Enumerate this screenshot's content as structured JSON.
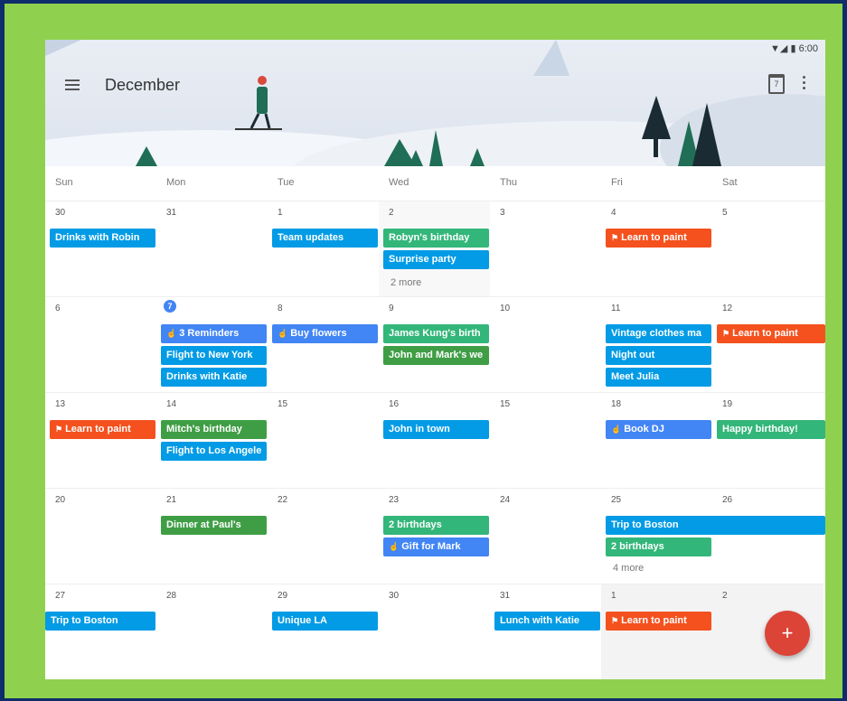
{
  "status": {
    "time": "6:00",
    "signals": "▼◢ ▮"
  },
  "header": {
    "month": "December",
    "date_icon": "7"
  },
  "weekdays": [
    "Sun",
    "Mon",
    "Tue",
    "Wed",
    "Thu",
    "Fri",
    "Sat"
  ],
  "days": [
    [
      "30",
      "31",
      "1",
      "2",
      "3",
      "4",
      "5"
    ],
    [
      "6",
      "7",
      "8",
      "9",
      "10",
      "11",
      "12"
    ],
    [
      "13",
      "14",
      "15",
      "16",
      "15",
      "18",
      "19"
    ],
    [
      "20",
      "21",
      "22",
      "23",
      "24",
      "25",
      "26"
    ],
    [
      "27",
      "28",
      "29",
      "30",
      "31",
      "1",
      "2"
    ]
  ],
  "events": {
    "drinks_robin": "Drinks with Robin",
    "team_updates": "Team updates",
    "robyn_birthday": "Robyn's birthday",
    "surprise_party": "Surprise party",
    "more_2": "2 more",
    "learn_paint": "Learn to paint",
    "reminders": "3 Reminders",
    "flight_ny": "Flight to New York",
    "drinks_katie": "Drinks with Katie",
    "buy_flowers": "Buy flowers",
    "james_kung": "James Kung's birth",
    "john_mark": "John and Mark's we",
    "vintage": "Vintage clothes ma",
    "night_out": "Night out",
    "meet_julia": "Meet Julia",
    "mitch": "Mitch's birthday",
    "flight_la": "Flight to Los Angele",
    "john_town": "John in town",
    "book_dj": "Book DJ",
    "happy_bday": "Happy birthday!",
    "dinner_paul": "Dinner at Paul's",
    "two_bdays": "2 birthdays",
    "gift_mark": "Gift for Mark",
    "trip_boston": "Trip to Boston",
    "more_4": "4 more",
    "unique_la": "Unique LA",
    "lunch_katie": "Lunch with Katie"
  },
  "fab_label": "+",
  "colors": {
    "blue": "#039be5",
    "green": "#33b679",
    "orange": "#f4511e",
    "lightblue": "#4285f4",
    "fab": "#db4437",
    "frame": "#8fd14f",
    "border": "#0f2d6b"
  }
}
